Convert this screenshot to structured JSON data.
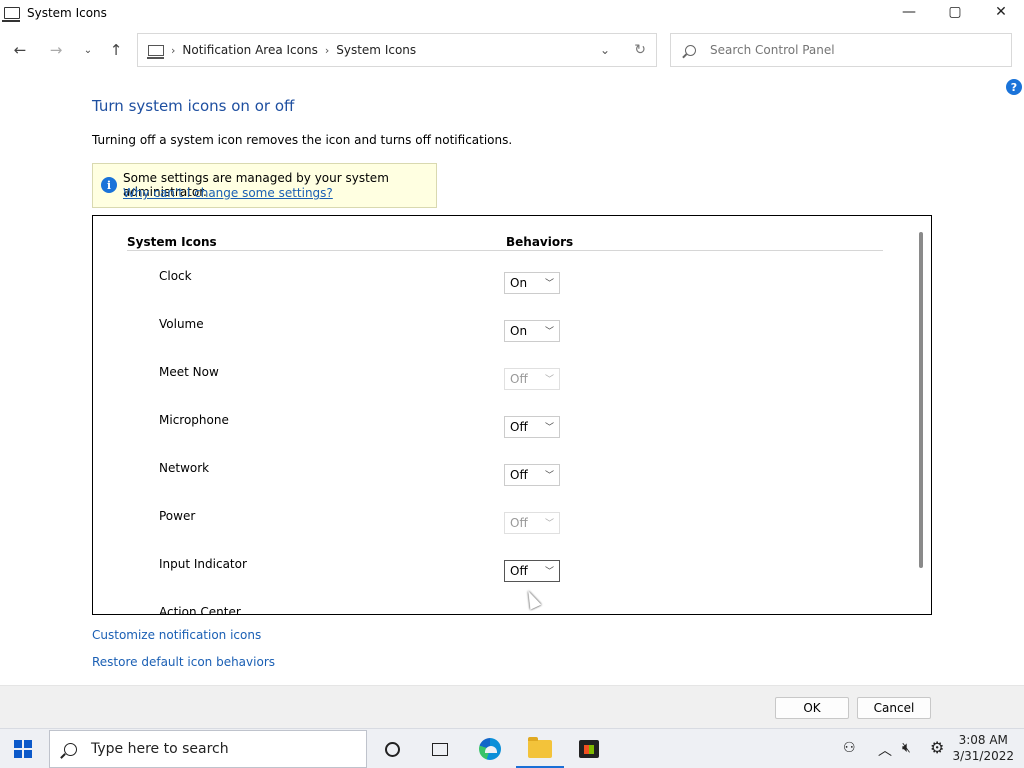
{
  "window": {
    "title": "System Icons",
    "controls": {
      "minimize": "—",
      "maximize": "▢",
      "close": "✕"
    }
  },
  "nav": {
    "breadcrumb": [
      "Notification Area Icons",
      "System Icons"
    ],
    "search_placeholder": "Search Control Panel"
  },
  "help_label": "?",
  "main": {
    "heading": "Turn system icons on or off",
    "description": "Turning off a system icon removes the icon and turns off notifications.",
    "notice": {
      "message": "Some settings are managed by your system administrator.",
      "link": "Why can't I change some settings?"
    },
    "table": {
      "col_icons": "System Icons",
      "col_behaviors": "Behaviors",
      "rows": [
        {
          "label": "Clock",
          "value": "On",
          "disabled": false
        },
        {
          "label": "Volume",
          "value": "On",
          "disabled": false
        },
        {
          "label": "Meet Now",
          "value": "Off",
          "disabled": true
        },
        {
          "label": "Microphone",
          "value": "Off",
          "disabled": false
        },
        {
          "label": "Network",
          "value": "Off",
          "disabled": false
        },
        {
          "label": "Power",
          "value": "Off",
          "disabled": true
        },
        {
          "label": "Input Indicator",
          "value": "Off",
          "disabled": false,
          "focused": true
        },
        {
          "label": "Action Center",
          "value": "",
          "disabled": false
        }
      ]
    },
    "links": {
      "customize": "Customize notification icons",
      "restore": "Restore default icon behaviors"
    }
  },
  "buttons": {
    "ok": "OK",
    "cancel": "Cancel"
  },
  "taskbar": {
    "search_placeholder": "Type here to search",
    "time": "3:08 AM",
    "date": "3/31/2022"
  }
}
